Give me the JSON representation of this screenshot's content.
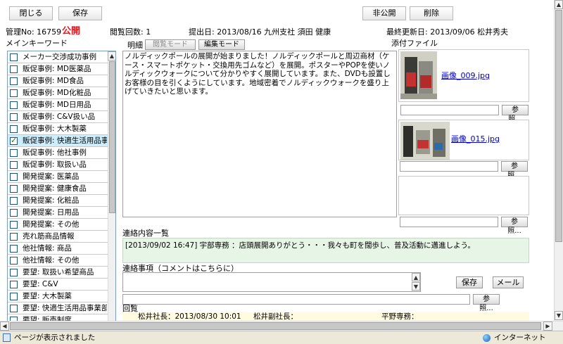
{
  "toolbar": {
    "close": "閉じる",
    "save": "保存",
    "private": "非公開",
    "delete": "削除"
  },
  "header": {
    "mgmt_no": "管理No: 16759",
    "public_label": "公開",
    "view_count": "閲覧回数: 1",
    "submitted": "提出日: 2013/08/16  九州支社  須田 健康",
    "last_updated": "最終更新日: 2013/09/06  松井秀夫"
  },
  "keywords": {
    "title": "メインキーワード",
    "items": [
      {
        "label": "メーカー交渉成功事例",
        "checked": false
      },
      {
        "label": "販促事例: MD医薬品",
        "checked": false
      },
      {
        "label": "販促事例: MD食品",
        "checked": false
      },
      {
        "label": "販促事例: MD化粧品",
        "checked": false
      },
      {
        "label": "販促事例: MD日用品",
        "checked": false
      },
      {
        "label": "販促事例: C&V扱い品",
        "checked": false
      },
      {
        "label": "販促事例: 大木製薬",
        "checked": false
      },
      {
        "label": "販促事例: 快適生活用品事業部",
        "checked": true
      },
      {
        "label": "販促事例: 他社事例",
        "checked": false
      },
      {
        "label": "販促事例: 取扱い品",
        "checked": false
      },
      {
        "label": "開発提案: 医薬品",
        "checked": false
      },
      {
        "label": "開発提案: 健康食品",
        "checked": false
      },
      {
        "label": "開発提案: 化粧品",
        "checked": false
      },
      {
        "label": "開発提案: 日用品",
        "checked": false
      },
      {
        "label": "開発提案: その他",
        "checked": false
      },
      {
        "label": "売れ筋商品情報",
        "checked": false
      },
      {
        "label": "他社情報: 商品",
        "checked": false
      },
      {
        "label": "他社情報: その他",
        "checked": false
      },
      {
        "label": "要望: 取扱い希望商品",
        "checked": false
      },
      {
        "label": "要望: C&V",
        "checked": false
      },
      {
        "label": "要望: 大木製薬",
        "checked": false
      },
      {
        "label": "要望: 快適生活用品事業部",
        "checked": false
      },
      {
        "label": "要望: 販売制度",
        "checked": false
      }
    ]
  },
  "detail": {
    "label": "明細",
    "view_mode": "閲覧モード",
    "edit_mode": "編集モード",
    "body": "ノルディックポールの展開が始まりました！ノルディックポールと周辺商材（ケース・スマートポケット・交換用先ゴムなど）を展開。ポスターやPOPを使いノルディックウォークについて分かりやすく展開しています。また、DVDも設置しお客様の目を引くようにしています。地域密着でノルディックウォークを盛り上げていきたいと思います。"
  },
  "attachments": {
    "title": "添付ファイル",
    "browse": "参照...",
    "files": [
      {
        "name": "画像_009.jpg"
      },
      {
        "name": "画像_015.jpg"
      },
      {
        "name": ""
      }
    ]
  },
  "contact_log": {
    "title": "連絡内容一覧",
    "entry": "[2013/09/02 16:47]  宇部専務 ：店頭展開ありがとう・・・我々も町を闊歩し、普及活動に邁進しよう。"
  },
  "comment": {
    "title": "連絡事項（コメントはこちらに）",
    "save": "保存",
    "mail": "メール",
    "browse": "参照..."
  },
  "circulation": {
    "title": "回覧",
    "president": "松井社長：2013/08/30 10:01",
    "vp": "松井副社長：",
    "director": "平野専務："
  },
  "status": {
    "text": "ページが表示されました",
    "zone": "インターネット"
  },
  "colors": {
    "public": "#e8161c",
    "link": "#0000cc",
    "log_bg": "#e6f5e6",
    "selected": "#cfeefd"
  }
}
